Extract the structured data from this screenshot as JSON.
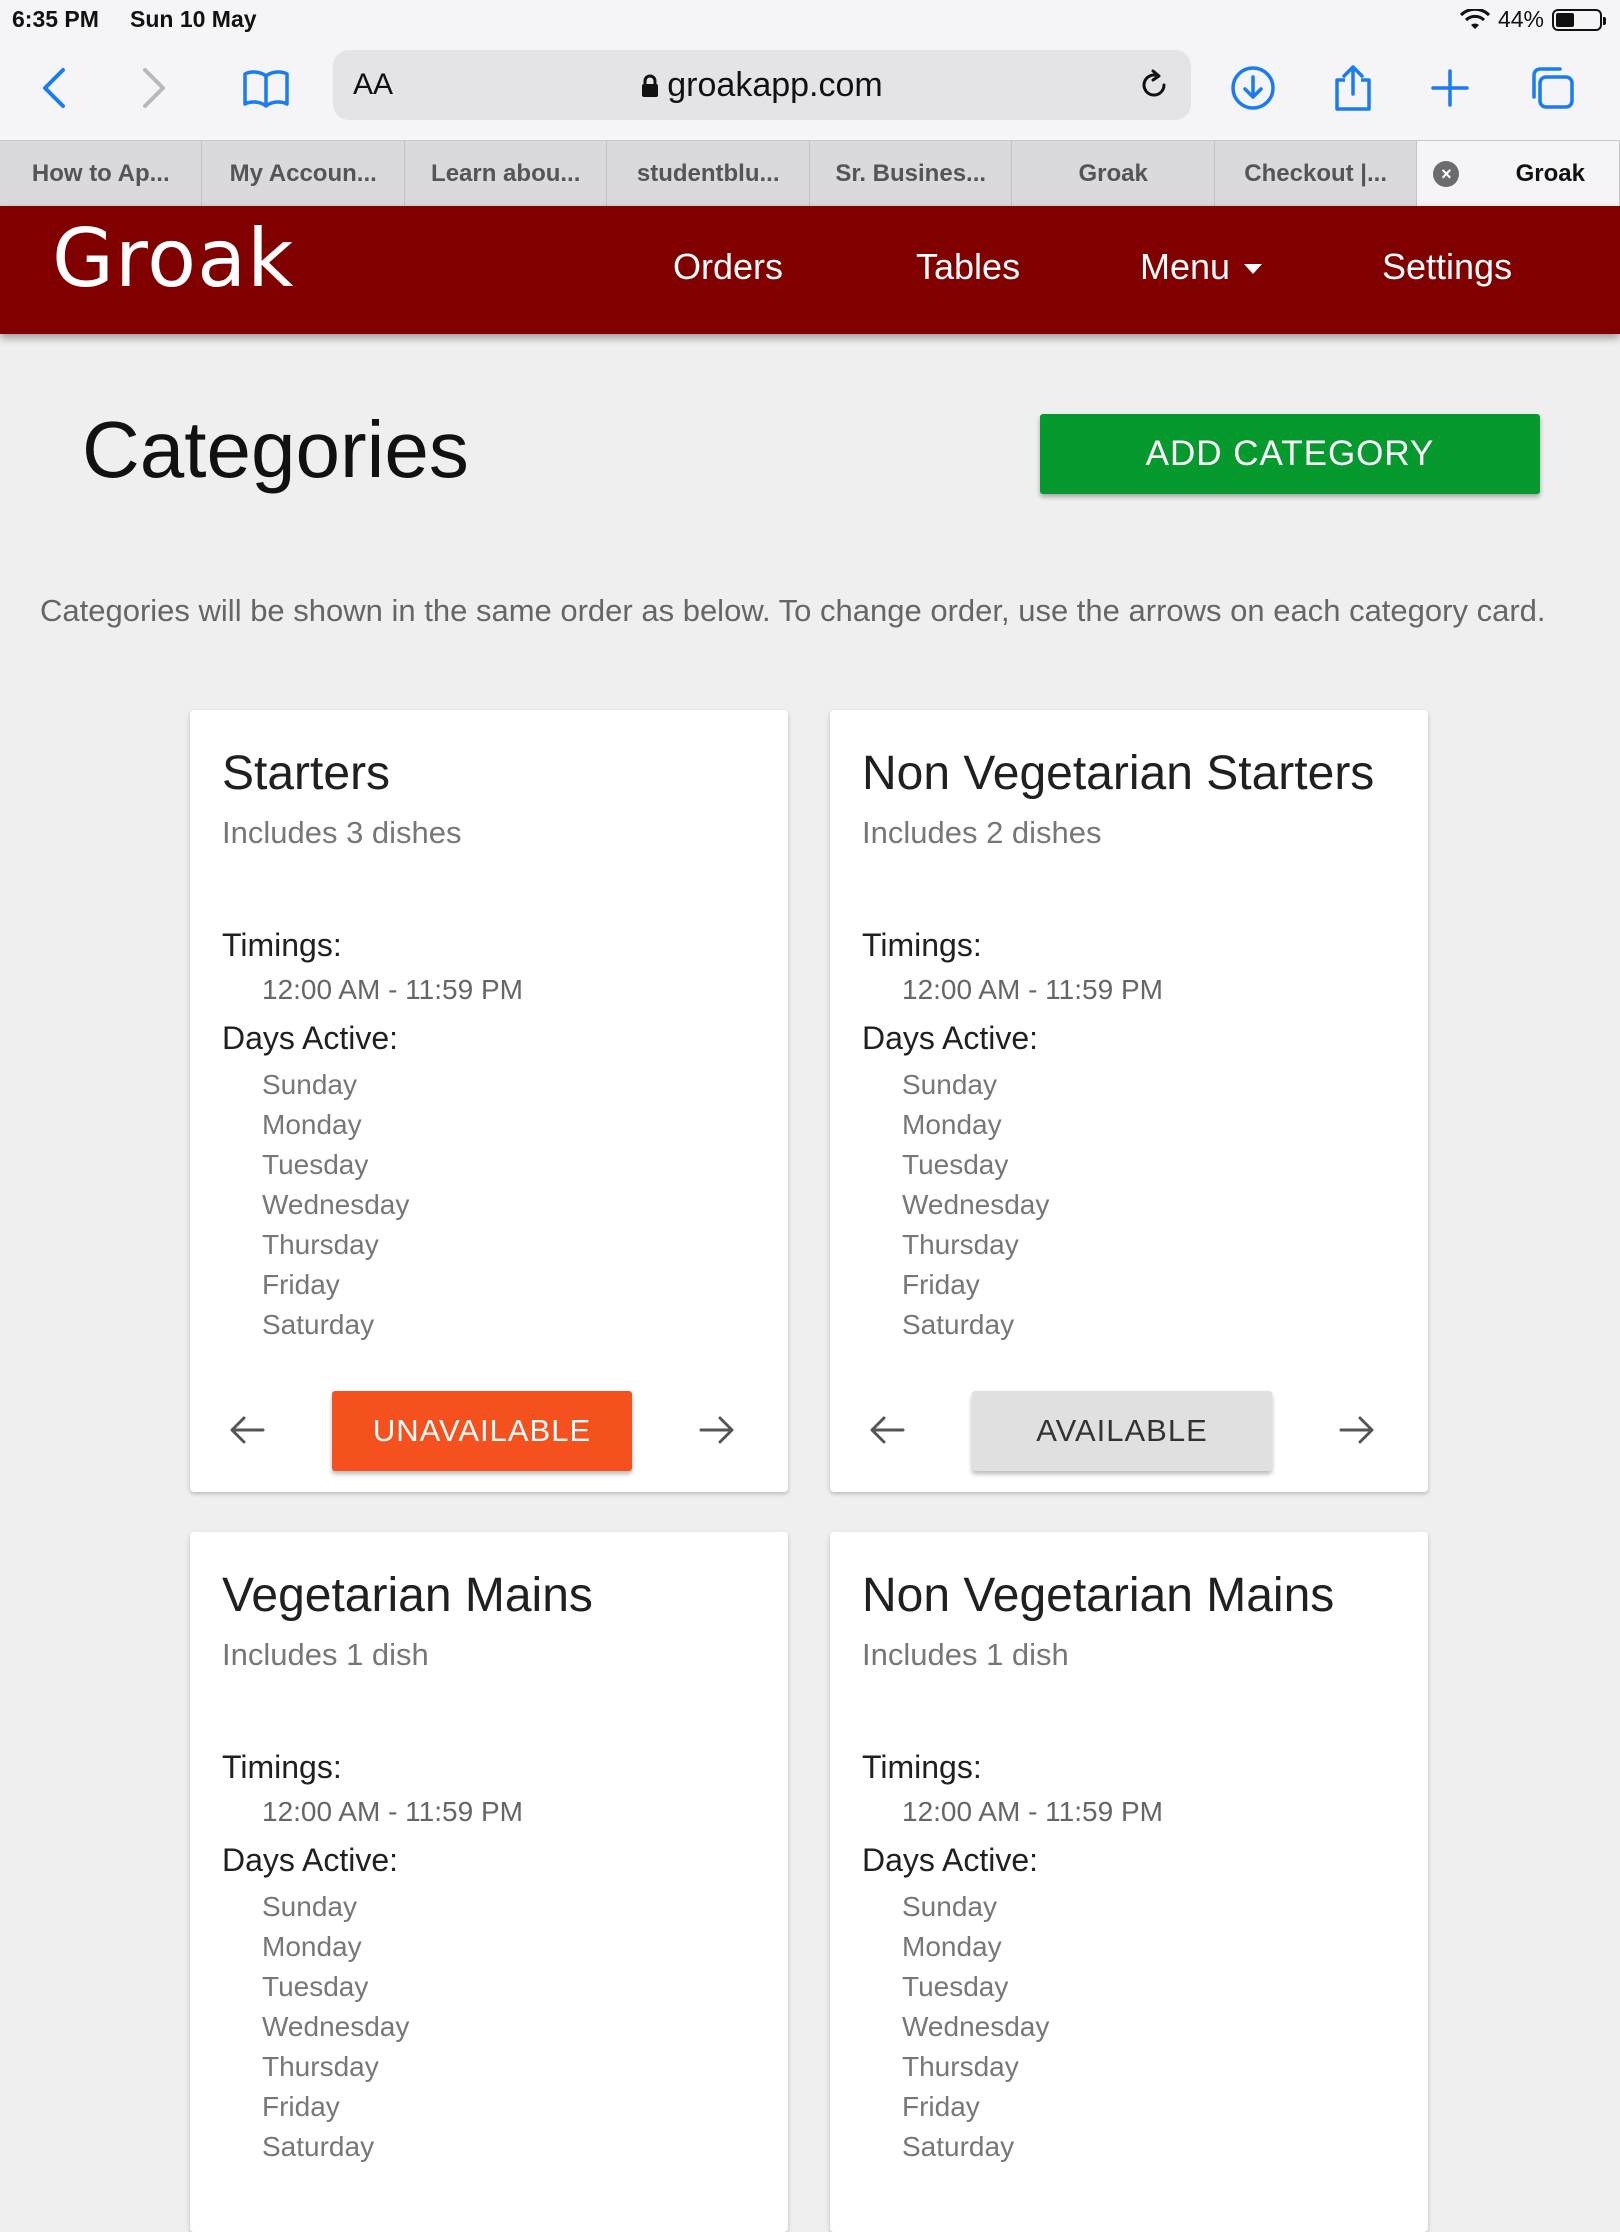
{
  "status_bar": {
    "time": "6:35 PM",
    "date": "Sun 10 May",
    "battery": "44%",
    "battery_level": 0.44
  },
  "browser": {
    "text_size_label": "AA",
    "url": "groakapp.com",
    "tabs": [
      "How to Ap...",
      "My Accoun...",
      "Learn abou...",
      "studentblu...",
      "Sr. Busines...",
      "Groak",
      "Checkout |...",
      "Groak"
    ]
  },
  "app": {
    "logo": "Groak",
    "nav": {
      "orders": "Orders",
      "tables": "Tables",
      "menu": "Menu",
      "settings": "Settings"
    },
    "page_title": "Categories",
    "add_button": "ADD CATEGORY",
    "hint": "Categories will be shown in the same order as below. To change order, use the arrows on each category card.",
    "labels": {
      "timings": "Timings:",
      "days_active": "Days Active:"
    },
    "categories": [
      {
        "name": "Starters",
        "count": "Includes 3 dishes",
        "timing": "12:00 AM - 11:59 PM",
        "days": [
          "Sunday",
          "Monday",
          "Tuesday",
          "Wednesday",
          "Thursday",
          "Friday",
          "Saturday"
        ],
        "status_button": "UNAVAILABLE"
      },
      {
        "name": "Non Vegetarian Starters",
        "count": "Includes 2 dishes",
        "timing": "12:00 AM - 11:59 PM",
        "days": [
          "Sunday",
          "Monday",
          "Tuesday",
          "Wednesday",
          "Thursday",
          "Friday",
          "Saturday"
        ],
        "status_button": "AVAILABLE"
      },
      {
        "name": "Vegetarian Mains",
        "count": "Includes 1 dish",
        "timing": "12:00 AM - 11:59 PM",
        "days": [
          "Sunday",
          "Monday",
          "Tuesday",
          "Wednesday",
          "Thursday",
          "Friday",
          "Saturday"
        ]
      },
      {
        "name": "Non Vegetarian Mains",
        "count": "Includes 1 dish",
        "timing": "12:00 AM - 11:59 PM",
        "days": [
          "Sunday",
          "Monday",
          "Tuesday",
          "Wednesday",
          "Thursday",
          "Friday",
          "Saturday"
        ]
      }
    ]
  },
  "colors": {
    "brand": "#800000",
    "add": "#069a2e",
    "unavailable": "#f4511e",
    "available": "#e0e0e0",
    "ios_blue": "#1a7cf0"
  }
}
